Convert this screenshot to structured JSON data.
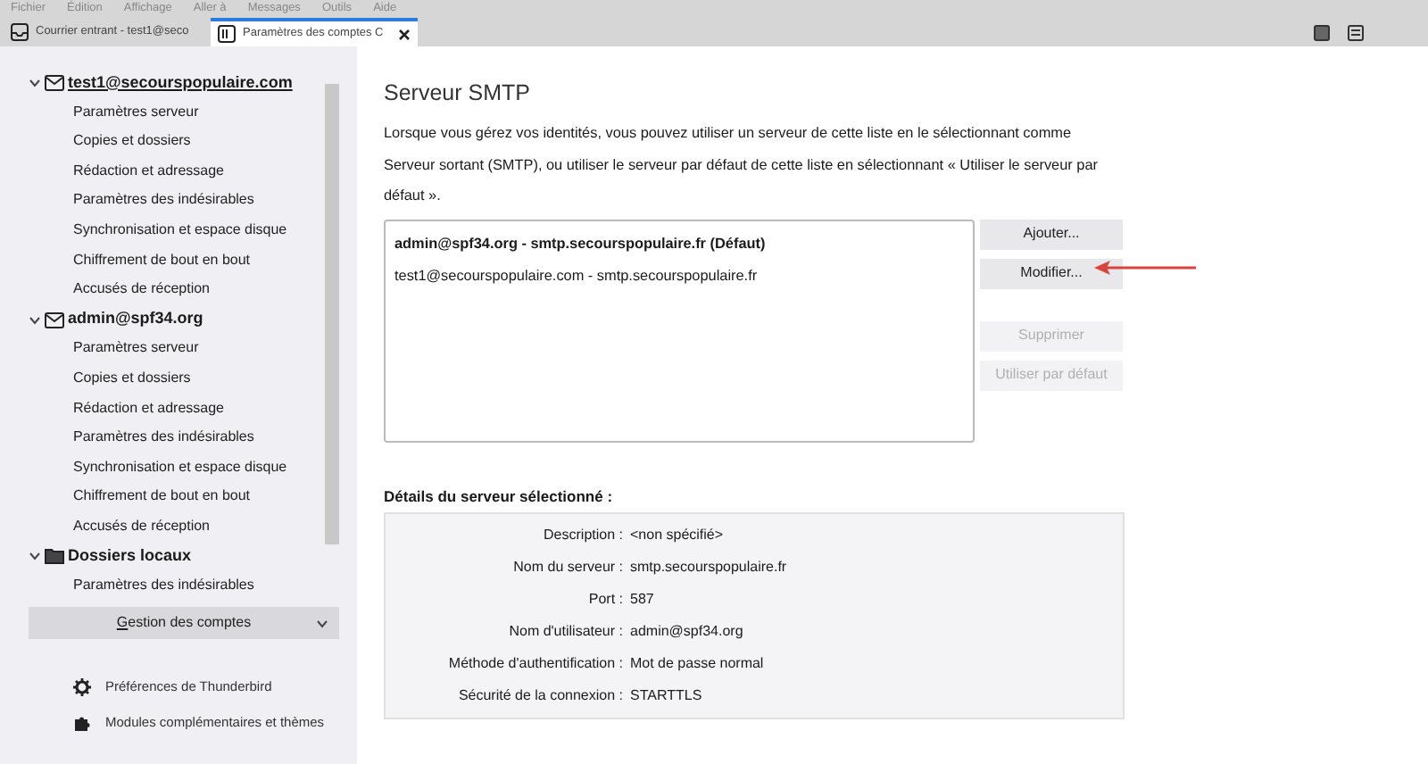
{
  "menu_bar": [
    "Fichier",
    "Édition",
    "Affichage",
    "Aller à",
    "Messages",
    "Outils",
    "Aide"
  ],
  "tabs": [
    {
      "label": "Courrier entrant - test1@seco",
      "kind": "mail",
      "selected": false,
      "closable": false
    },
    {
      "label": "Paramètres des comptes C",
      "kind": "settings",
      "selected": true,
      "closable": true
    }
  ],
  "sidebar": {
    "accounts": [
      {
        "name": "test1@secourspopulaire.com",
        "kind": "mail",
        "expanded": true,
        "selected": true,
        "children": [
          "Paramètres serveur",
          "Copies et dossiers",
          "Rédaction et adressage",
          "Paramètres des indésirables",
          "Synchronisation et espace disque",
          "Chiffrement de bout en bout",
          "Accusés de réception"
        ]
      },
      {
        "name": "admin@spf34.org",
        "kind": "mail",
        "expanded": true,
        "selected": false,
        "children": [
          "Paramètres serveur",
          "Copies et dossiers",
          "Rédaction et adressage",
          "Paramètres des indésirables",
          "Synchronisation et espace disque",
          "Chiffrement de bout en bout",
          "Accusés de réception"
        ]
      },
      {
        "name": "Dossiers locaux",
        "kind": "folder",
        "expanded": true,
        "selected": false,
        "children": [
          "Paramètres des indésirables"
        ]
      }
    ],
    "account_actions": {
      "label": "Gestion des comptes"
    },
    "footer": [
      {
        "label": "Préférences de Thunderbird",
        "kind": "gear"
      },
      {
        "label": "Modules complémentaires et thèmes",
        "kind": "puzzle"
      }
    ]
  },
  "main": {
    "title": "Serveur SMTP",
    "description": "Lorsque vous gérez vos identités, vous pouvez utiliser un serveur de cette liste en le sélectionnant comme Serveur sortant (SMTP), ou utiliser le serveur par défaut de cette liste en sélectionnant « Utiliser le serveur par défaut ».",
    "servers": [
      {
        "label": "admin@spf34.org - smtp.secourspopulaire.fr (Défaut)",
        "default": true
      },
      {
        "label": "test1@secourspopulaire.com - smtp.secourspopulaire.fr",
        "default": false
      }
    ],
    "buttons": [
      {
        "label": "Ajouter...",
        "disabled": false
      },
      {
        "label": "Modifier...",
        "disabled": false
      },
      {
        "label": "Supprimer",
        "disabled": true
      },
      {
        "label": "Utiliser par défaut",
        "disabled": true
      }
    ],
    "details_title": "Détails du serveur sélectionné :",
    "details": [
      {
        "label": "Description :",
        "value": "<non spécifié>"
      },
      {
        "label": "Nom du serveur :",
        "value": "smtp.secourspopulaire.fr"
      },
      {
        "label": "Port :",
        "value": "587"
      },
      {
        "label": "Nom d'utilisateur :",
        "value": "admin@spf34.org"
      },
      {
        "label": "Méthode d'authentification :",
        "value": "Mot de passe normal"
      },
      {
        "label": "Sécurité de la connexion :",
        "value": "STARTTLS"
      }
    ]
  }
}
